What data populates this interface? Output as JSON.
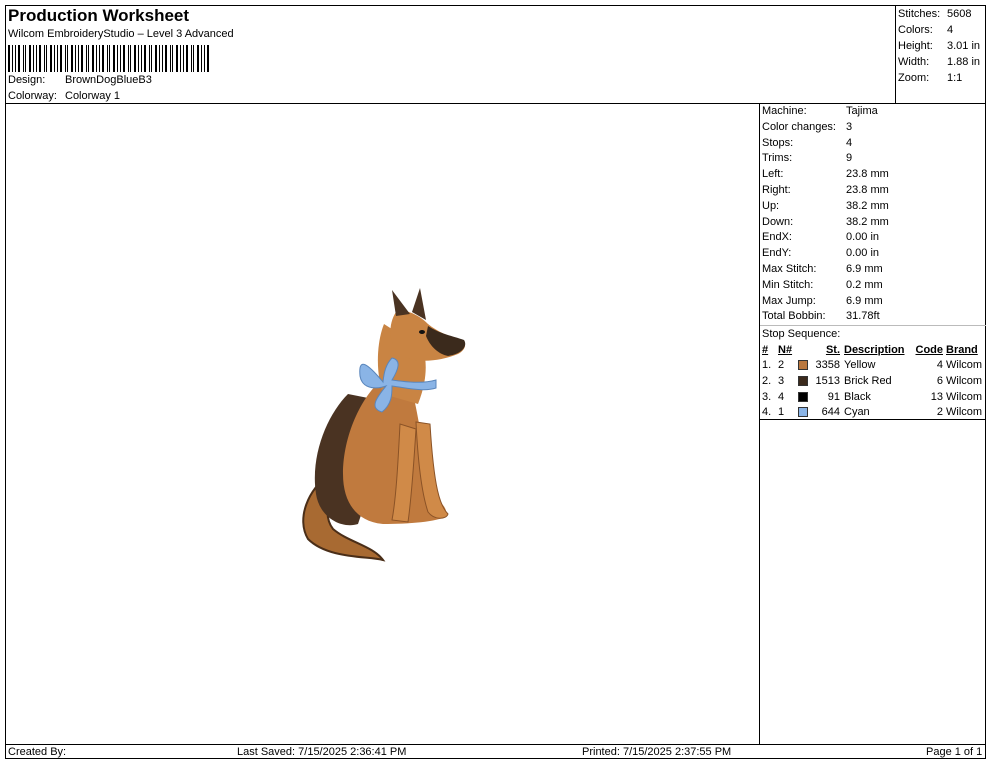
{
  "header": {
    "title": "Production Worksheet",
    "software": "Wilcom EmbroideryStudio – Level 3 Advanced",
    "design_label": "Design:",
    "design_value": "BrownDogBlueB3",
    "colorway_label": "Colorway:",
    "colorway_value": "Colorway 1"
  },
  "summary": [
    {
      "label": "Stitches:",
      "value": "5608"
    },
    {
      "label": "Colors:",
      "value": "4"
    },
    {
      "label": "Height:",
      "value": "3.01 in"
    },
    {
      "label": "Width:",
      "value": "1.88 in"
    },
    {
      "label": "Zoom:",
      "value": "1:1"
    }
  ],
  "details": [
    {
      "label": "Machine:",
      "value": "Tajima"
    },
    {
      "label": "Color changes:",
      "value": "3"
    },
    {
      "label": "Stops:",
      "value": "4"
    },
    {
      "label": "Trims:",
      "value": "9"
    },
    {
      "label": "Left:",
      "value": "23.8 mm"
    },
    {
      "label": "Right:",
      "value": "23.8 mm"
    },
    {
      "label": "Up:",
      "value": "38.2 mm"
    },
    {
      "label": "Down:",
      "value": "38.2 mm"
    },
    {
      "label": "EndX:",
      "value": "0.00 in"
    },
    {
      "label": "EndY:",
      "value": "0.00 in"
    },
    {
      "label": "Max Stitch:",
      "value": "6.9 mm"
    },
    {
      "label": "Min Stitch:",
      "value": "0.2 mm"
    },
    {
      "label": "Max Jump:",
      "value": "6.9 mm"
    },
    {
      "label": "Total Bobbin:",
      "value": "31.78ft"
    }
  ],
  "stop_sequence": {
    "title": "Stop Sequence:",
    "columns": [
      "#",
      "N#",
      "St.",
      "Description",
      "Code",
      "Brand"
    ],
    "rows": [
      {
        "num": "1.",
        "n": "2",
        "color": "#b9773e",
        "st": "3358",
        "desc": "Yellow",
        "code": "4",
        "brand": "Wilcom"
      },
      {
        "num": "2.",
        "n": "3",
        "color": "#3b2a1c",
        "st": "1513",
        "desc": "Brick Red",
        "code": "6",
        "brand": "Wilcom"
      },
      {
        "num": "3.",
        "n": "4",
        "color": "#000000",
        "st": "91",
        "desc": "Black",
        "code": "13",
        "brand": "Wilcom"
      },
      {
        "num": "4.",
        "n": "1",
        "color": "#8ab4e6",
        "st": "644",
        "desc": "Cyan",
        "code": "2",
        "brand": "Wilcom"
      }
    ]
  },
  "footer": {
    "created": "Created By:",
    "saved": "Last Saved: 7/15/2025 2:36:41 PM",
    "printed": "Printed: 7/15/2025 2:37:55 PM",
    "page": "Page 1 of 1"
  }
}
